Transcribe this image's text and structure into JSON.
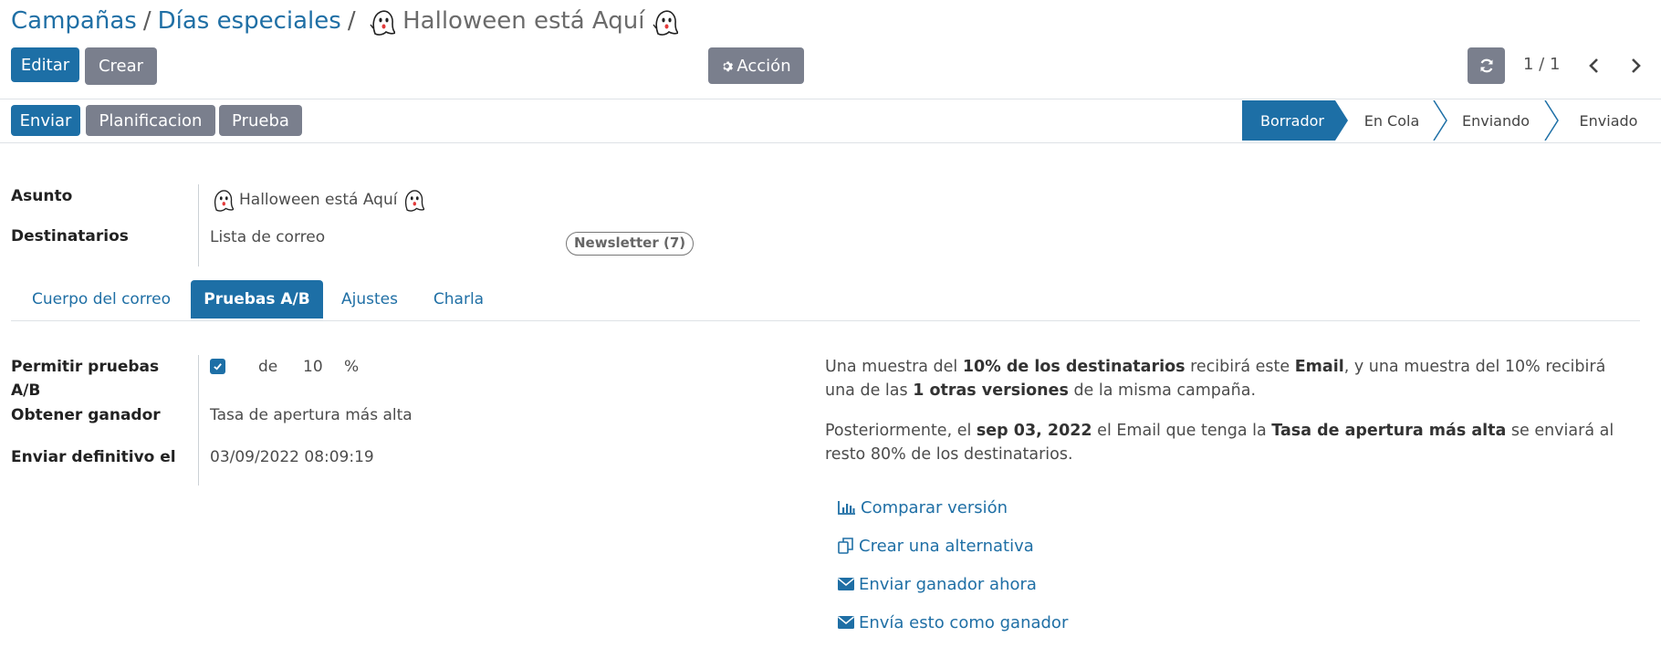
{
  "breadcrumb": {
    "items": [
      "Campañas",
      "Días especiales"
    ],
    "separator": "/",
    "current": "Halloween está Aquí"
  },
  "toolbar": {
    "edit": "Editar",
    "create": "Crear",
    "action": "Acción",
    "pager": "1 / 1"
  },
  "header_buttons": {
    "send": "Enviar",
    "schedule": "Planificacion",
    "test": "Prueba"
  },
  "statusbar": {
    "stages": [
      "Borrador",
      "En Cola",
      "Enviando",
      "Enviado"
    ],
    "active_index": 0
  },
  "fields": {
    "subject_label": "Asunto",
    "subject_value": "Halloween está Aquí",
    "recipients_label": "Destinatarios",
    "recipients_value": "Lista de correo",
    "recipients_tag": "Newsletter (7)"
  },
  "tabs": [
    "Cuerpo del correo",
    "Pruebas A/B",
    "Ajustes",
    "Charla"
  ],
  "active_tab": 1,
  "ab": {
    "allow_label_line1": "Permitir pruebas",
    "allow_label_line2": "A/B",
    "allow_checked": true,
    "of": "de",
    "percent_value": "10",
    "percent_sign": "%",
    "winner_label": "Obtener ganador",
    "winner_value": "Tasa de apertura más alta",
    "final_send_label": "Enviar definitivo el",
    "final_send_value": "03/09/2022 08:09:19"
  },
  "info": {
    "p1": {
      "t1": "Una muestra del ",
      "b1": "10% de los destinatarios",
      "t2": " recibirá este ",
      "b2": "Email",
      "t3": ", y una muestra del 10% recibirá una de las ",
      "b3": "1 otras versiones",
      "t4": " de la misma campaña."
    },
    "p2": {
      "t1": "Posteriormente, el ",
      "b1": "sep 03, 2022",
      "t2": " el Email que tenga la ",
      "b2": "Tasa de apertura más alta",
      "t3": " se enviará al resto 80% de los destinatarios."
    }
  },
  "links": {
    "compare": "Comparar versión",
    "alternative": "Crear una alternativa",
    "send_winner": "Enviar ganador ahora",
    "send_as_winner": "Envía esto como ganador"
  },
  "colors": {
    "primary": "#1d6fa6",
    "secondary": "#7a7f8d",
    "link": "#1f6fa5"
  }
}
